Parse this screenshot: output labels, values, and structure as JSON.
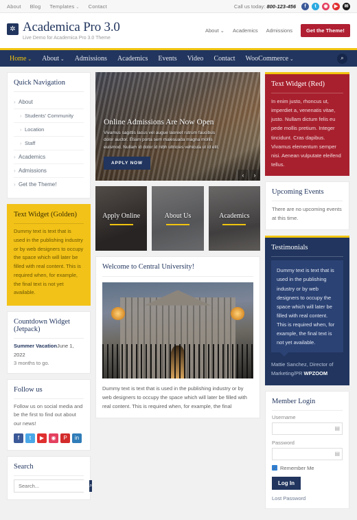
{
  "topbar": {
    "nav": [
      {
        "label": "About",
        "caret": false
      },
      {
        "label": "Blog",
        "caret": false
      },
      {
        "label": "Templates",
        "caret": true
      },
      {
        "label": "Contact",
        "caret": false
      }
    ],
    "call_label": "Call us today:",
    "phone": "800-123-456",
    "socials": [
      {
        "name": "facebook-icon",
        "glyph": "f",
        "color": "#3b5998"
      },
      {
        "name": "twitter-icon",
        "glyph": "t",
        "color": "#2aa9e0"
      },
      {
        "name": "instagram-icon",
        "glyph": "◉",
        "color": "#e4405f"
      },
      {
        "name": "youtube-icon",
        "glyph": "▶",
        "color": "#e02f2f"
      },
      {
        "name": "email-icon",
        "glyph": "✉",
        "color": "#1b1b1b"
      }
    ]
  },
  "header": {
    "logo_icon": "gear-icon",
    "logo_glyph": "✲",
    "title": "Academica Pro 3.0",
    "description": "Live Demo for Academica Pro 3.0 Theme",
    "nav": [
      {
        "label": "About",
        "caret": true
      },
      {
        "label": "Academics",
        "caret": false
      },
      {
        "label": "Admissions",
        "caret": false
      }
    ],
    "cta_label": "Get the Theme!"
  },
  "mainnav": {
    "items": [
      {
        "label": "Home",
        "caret": true,
        "active": true
      },
      {
        "label": "About",
        "caret": true,
        "active": false
      },
      {
        "label": "Admissions",
        "caret": false,
        "active": false
      },
      {
        "label": "Academics",
        "caret": false,
        "active": false
      },
      {
        "label": "Events",
        "caret": false,
        "active": false
      },
      {
        "label": "Video",
        "caret": false,
        "active": false
      },
      {
        "label": "Contact",
        "caret": false,
        "active": false
      },
      {
        "label": "WooCommerce",
        "caret": true,
        "active": false
      }
    ],
    "search_icon": "search-icon",
    "search_glyph": "⌕"
  },
  "left": {
    "quicknav": {
      "title": "Quick Navigation",
      "items": [
        {
          "label": "About",
          "sub": false
        },
        {
          "label": "Students' Community",
          "sub": true
        },
        {
          "label": "Location",
          "sub": true
        },
        {
          "label": "Staff",
          "sub": true
        },
        {
          "label": "Academics",
          "sub": false
        },
        {
          "label": "Admissions",
          "sub": false
        },
        {
          "label": "Get the Theme!",
          "sub": false
        }
      ]
    },
    "golden": {
      "title": "Text Widget (Golden)",
      "body": "Dummy text is text that is used in the publishing industry or by web designers to occupy the space which will later be filled with real content. This is required when, for example, the final text is not yet available."
    },
    "countdown": {
      "title": "Countdown Widget (Jetpack)",
      "event": "Summer Vacation",
      "date": "June 1, 2022",
      "remaining": "3 months to go."
    },
    "follow": {
      "title": "Follow us",
      "body": "Follow us on social media and be the first to find out about our news!",
      "icons": [
        {
          "name": "facebook-icon",
          "glyph": "f",
          "color": "#3b5998"
        },
        {
          "name": "twitter-icon",
          "glyph": "t",
          "color": "#4aa8e8"
        },
        {
          "name": "youtube-icon",
          "glyph": "▶",
          "color": "#e02f2f"
        },
        {
          "name": "instagram-icon",
          "glyph": "◉",
          "color": "#e4405f"
        },
        {
          "name": "pinterest-icon",
          "glyph": "P",
          "color": "#d32b2b"
        },
        {
          "name": "linkedin-icon",
          "glyph": "in",
          "color": "#2f7cb8"
        }
      ]
    },
    "search": {
      "title": "Search",
      "placeholder": "Search...",
      "value": "",
      "button_icon": "search-icon",
      "button_glyph": "⌕"
    }
  },
  "slider": {
    "title": "Online Admissions Are Now Open",
    "description": "Vivamus sagittis lacus vel augue laoreet rutrum faucibus dolor auctor. Etiam porta sem malesuada magna mollis euismod. Nullam id dolor id nibh ultricies vehicula ut id elit.",
    "button_label": "APPLY NOW",
    "prev_glyph": "‹",
    "next_glyph": "›"
  },
  "tiles": [
    {
      "label": "Apply Online"
    },
    {
      "label": "About Us"
    },
    {
      "label": "Academics"
    }
  ],
  "welcome": {
    "title": "Welcome to Central University!",
    "image_name": "university-building-photo",
    "body": "Dummy text is text that is used in the publishing industry or by web designers to occupy the space which will later be filled with real content. This is required when, for example, the final"
  },
  "right": {
    "red": {
      "title": "Text Widget (Red)",
      "body": "In enim justo, rhoncus ut, imperdiet a, venenatis vitae, justo. Nullam dictum felis eu pede mollis pretium. Integer tincidunt. Cras dapibus. Vivamus elementum semper nisi. Aenean vulputate eleifend tellus."
    },
    "upcoming": {
      "title": "Upcoming Events",
      "body": "There are no upcoming events at this time."
    },
    "testimonials": {
      "title": "Testimonials",
      "quote": "Dummy text is text that is used in the publishing industry or by web designers to occupy the space which will later be filled with real content. This is required when, for example, the final text is not yet available.",
      "cite_name": "Mattie Sanchez, Director of Marketing/PR",
      "cite_company": "WPZOOM"
    },
    "login": {
      "title": "Member Login",
      "username_label": "Username",
      "username_value": "",
      "password_label": "Password",
      "password_value": "",
      "remember_label": "Remember Me",
      "remember_checked": true,
      "submit_label": "Log In",
      "lost_password_label": "Lost Password"
    }
  },
  "colors": {
    "navy": "#21355e",
    "gold": "#f1c40f",
    "red": "#a8202e",
    "crimson": "#b01f32",
    "golden_widget": "#f2c218"
  }
}
